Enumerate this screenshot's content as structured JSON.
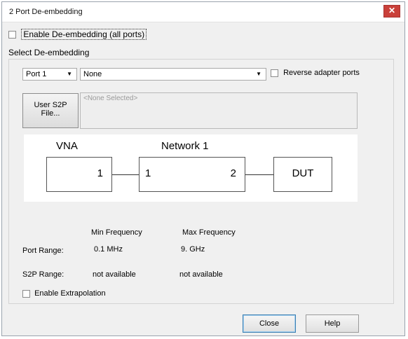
{
  "window": {
    "title": "2 Port De-embedding",
    "close_glyph": "✕"
  },
  "enable_deembedding": {
    "label": "Enable De-embedding (all ports)",
    "checked": false
  },
  "select_deembedding": {
    "group_label": "Select De-embedding",
    "port_dropdown": {
      "value": "Port 1"
    },
    "type_dropdown": {
      "value": "None"
    },
    "reverse_adapter": {
      "label": "Reverse adapter ports",
      "checked": false
    },
    "user_file_button": {
      "line1": "User S2P",
      "line2": "File..."
    },
    "file_path_placeholder": "<None Selected>"
  },
  "diagram": {
    "vna_label": "VNA",
    "network_label": "Network 1",
    "vna_port": "1",
    "network_port_left": "1",
    "network_port_right": "2",
    "dut_label": "DUT"
  },
  "frequency_table": {
    "min_header": "Min Frequency",
    "max_header": "Max Frequency",
    "rows": [
      {
        "label": "Port Range:",
        "min": "0.1 MHz",
        "max": "9. GHz"
      },
      {
        "label": "S2P Range:",
        "min": "not available",
        "max": "not available"
      }
    ]
  },
  "extrapolation": {
    "label": "Enable Extrapolation",
    "checked": false
  },
  "footer": {
    "close_label": "Close",
    "help_label": "Help"
  },
  "colors": {
    "window_bg": "#f0f0f0",
    "close_button": "#c9403a",
    "primary_button_border": "#3c7fb1"
  }
}
